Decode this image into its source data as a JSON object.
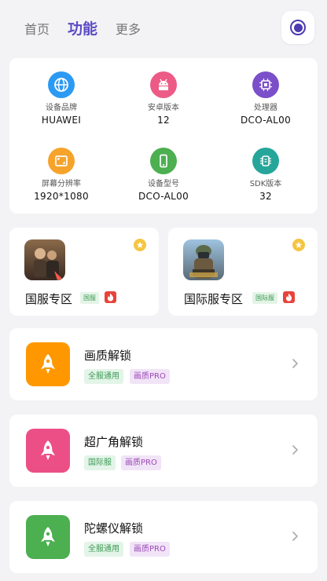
{
  "nav": {
    "tabs": [
      {
        "label": "首页",
        "active": false
      },
      {
        "label": "功能",
        "active": true
      },
      {
        "label": "更多",
        "active": false
      }
    ],
    "record_icon": "record-icon"
  },
  "device_info": [
    {
      "label": "设备品牌",
      "value": "HUAWEI",
      "icon": "globe-icon",
      "color": "#2b9af3"
    },
    {
      "label": "安卓版本",
      "value": "12",
      "icon": "android-icon",
      "color": "#ec5b86"
    },
    {
      "label": "处理器",
      "value": "DCO-AL00",
      "icon": "chip-icon",
      "color": "#7b4fc9"
    },
    {
      "label": "屏幕分辨率",
      "value": "1920*1080",
      "icon": "screen-icon",
      "color": "#f6a32c"
    },
    {
      "label": "设备型号",
      "value": "DCO-AL00",
      "icon": "phone-icon",
      "color": "#4caf50"
    },
    {
      "label": "SDK版本",
      "value": "32",
      "icon": "sdk-icon",
      "color": "#26a69a"
    }
  ],
  "games": [
    {
      "title": "国服专区",
      "tag": "国服",
      "thumb_icon": "game-thumb-cn"
    },
    {
      "title": "国际服专区",
      "tag": "国际服",
      "thumb_icon": "game-thumb-intl"
    }
  ],
  "features": [
    {
      "title": "画质解锁",
      "tags": [
        "全服通用",
        "画质PRO"
      ],
      "icon": "rocket-icon",
      "color": "#ff9800"
    },
    {
      "title": "超广角解锁",
      "tags": [
        "国际服",
        "画质PRO"
      ],
      "icon": "rocket-icon",
      "color": "#ec4f86"
    },
    {
      "title": "陀螺仪解锁",
      "tags": [
        "全服通用",
        "画质PRO"
      ],
      "icon": "rocket-icon",
      "color": "#4caf50"
    }
  ],
  "colors": {
    "accent": "#5b4cc4",
    "background": "#f3f3f5",
    "star": "#f5c542",
    "fire": "#e8433a"
  }
}
